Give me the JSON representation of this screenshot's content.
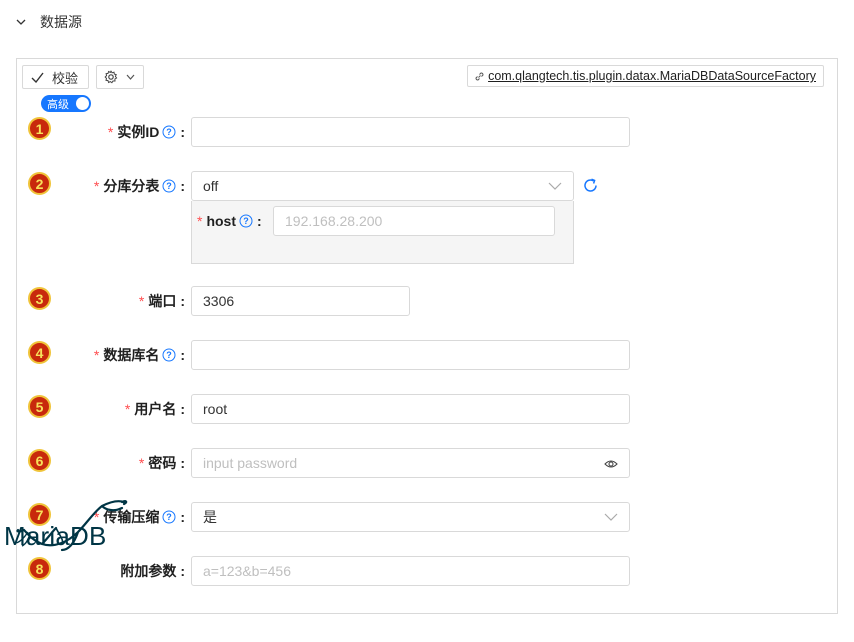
{
  "section": {
    "title": "数据源"
  },
  "toolbar": {
    "verify_label": "校验",
    "factory_class": "com.qlangtech.tis.plugin.datax.MariaDBDataSourceFactory"
  },
  "advanced_toggle": {
    "label": "高级",
    "state": "on"
  },
  "fields": [
    {
      "badge": "1",
      "label": "实例ID",
      "required": true,
      "help": true,
      "value": "",
      "placeholder": ""
    },
    {
      "badge": "2",
      "label": "分库分表",
      "required": true,
      "help": true,
      "value": "off",
      "placeholder": ""
    },
    {
      "badge": "3",
      "label": "端口",
      "required": true,
      "help": false,
      "value": "3306",
      "placeholder": ""
    },
    {
      "badge": "4",
      "label": "数据库名",
      "required": true,
      "help": true,
      "value": "",
      "placeholder": ""
    },
    {
      "badge": "5",
      "label": "用户名",
      "required": true,
      "help": false,
      "value": "root",
      "placeholder": ""
    },
    {
      "badge": "6",
      "label": "密码",
      "required": true,
      "help": false,
      "value": "",
      "placeholder": "input password"
    },
    {
      "badge": "7",
      "label": "传输压缩",
      "required": true,
      "help": true,
      "value": "是",
      "placeholder": ""
    },
    {
      "badge": "8",
      "label": "附加参数",
      "required": false,
      "help": false,
      "value": "",
      "placeholder": "a=123&b=456"
    }
  ],
  "sub_field": {
    "label": "host",
    "required": true,
    "help": true,
    "value": "",
    "placeholder": "192.168.28.200"
  },
  "logo": {
    "text": "MariaDB",
    "color": "#003545"
  },
  "colors": {
    "accent": "#1677ff",
    "required": "#ff4d4f",
    "badge": "#c8290c"
  }
}
